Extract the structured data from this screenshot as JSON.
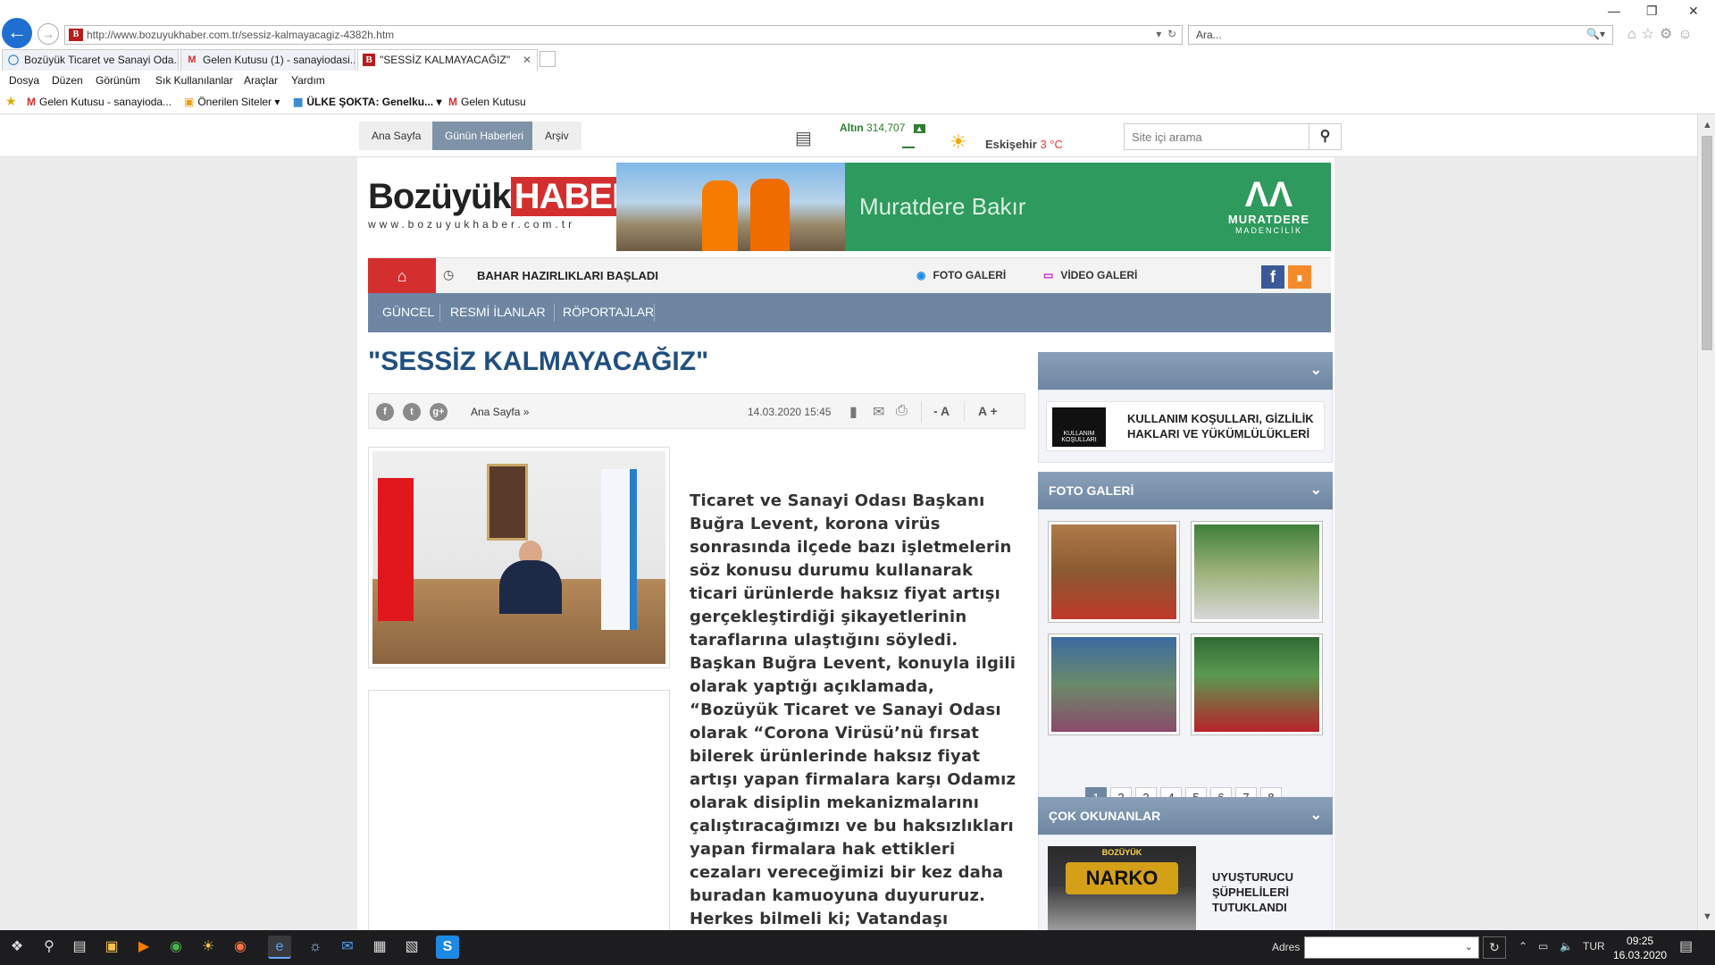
{
  "browser": {
    "url": "http://www.bozuyukhaber.com.tr/sessiz-kalmayacagiz-4382h.htm",
    "url_host": "bozuyukhaber.com.tr",
    "search_placeholder": "Ara...",
    "tabs": [
      {
        "label": "Bozüyük Ticaret ve Sanayi Oda...",
        "active": false
      },
      {
        "label": "Gelen Kutusu (1) - sanayiodasi...",
        "active": false
      },
      {
        "label": "\"SESSİZ KALMAYACAĞIZ\"",
        "active": true
      }
    ],
    "menu": [
      "Dosya",
      "Düzen",
      "Görünüm",
      "Sık Kullanılanlar",
      "Araçlar",
      "Yardım"
    ],
    "favorites": [
      {
        "label": "Gelen Kutusu - sanayioda..."
      },
      {
        "label": "Önerilen Siteler ▾"
      },
      {
        "label": "ÜLKE ŞOKTA: Genelku... ▾"
      },
      {
        "label": "Gelen Kutusu"
      }
    ]
  },
  "sitebar": {
    "buttons": [
      "Ana Sayfa",
      "Günün Haberleri",
      "Arşiv"
    ],
    "gold_label": "Altın",
    "gold_value": "314,707",
    "city": "Eskişehir",
    "temp": "3 °C",
    "search_placeholder": "Site içi arama"
  },
  "logo": {
    "part1": "Bozüyük",
    "part2": "HABER",
    "domain": "www.bozuyukhaber.com.tr"
  },
  "banner": {
    "text": "Muratdere Bakır",
    "brand": "MURATDERE",
    "brand_sub": "MADENCİLİK"
  },
  "navbar": {
    "ticker": "BAHAR HAZIRLIKLARI BAŞLADI",
    "photo_gallery": "FOTO GALERİ",
    "video_gallery": "VİDEO GALERİ"
  },
  "categories": [
    "GÜNCEL",
    "RESMİ İLANLAR",
    "RÖPORTAJLAR"
  ],
  "article": {
    "title": "\"SESSİZ KALMAYACAĞIZ\"",
    "breadcrumb": "Ana Sayfa  »",
    "date": "14.03.2020 15:45",
    "font_minus": "- A",
    "font_plus": "A +",
    "paragraphs": [
      "Ticaret ve Sanayi Odası Başkanı Buğra Levent, korona virüs sonrasında ilçede bazı işletmelerin söz konusu durumu kullanarak ticari ürünlerde haksız fiyat artışı gerçekleştirdiği şikayetlerinin taraflarına ulaştığını söyledi.",
      "Başkan Buğra Levent, konuyla ilgili olarak yaptığı açıklamada, “Bozüyük Ticaret ve Sanayi Odası olarak “Corona Virüsü’nü fırsat bilerek ürünlerinde haksız fiyat artışı yapan firmalara karşı Odamız olarak disiplin mekanizmalarını çalıştıracağımızı ve bu haksızlıkları yapan firmalara hak ettikleri cezaları vereceğimizi bir kez daha buradan kamuoyuna duyururuz. Herkes bilmeli ki; Vatandaşı mağdur edenlere karşı sessiz kalmayacağız” dedi.-İHA-"
    ]
  },
  "sidebar": {
    "terms_icon_text": "KULLANIM KOŞULLARI",
    "terms_title": "KULLANIM KOŞULLARI, GİZLİLİK HAKLARI VE YÜKÜMLÜLÜKLERİ",
    "gallery_title": "FOTO GALERİ",
    "pages": [
      "1",
      "2",
      "3",
      "4",
      "5",
      "6",
      "7",
      "8"
    ],
    "most_read_title": "ÇOK OKUNANLAR",
    "most_read_img_top": "BOZÜYÜK",
    "most_read_img_badge": "NARKO",
    "most_read_item": "UYUŞTURUCU ŞÜPHELİLERİ TUTUKLANDI"
  },
  "taskbar": {
    "address_label": "Adres",
    "lang": "TUR",
    "time": "09:25",
    "date": "16.03.2020"
  }
}
